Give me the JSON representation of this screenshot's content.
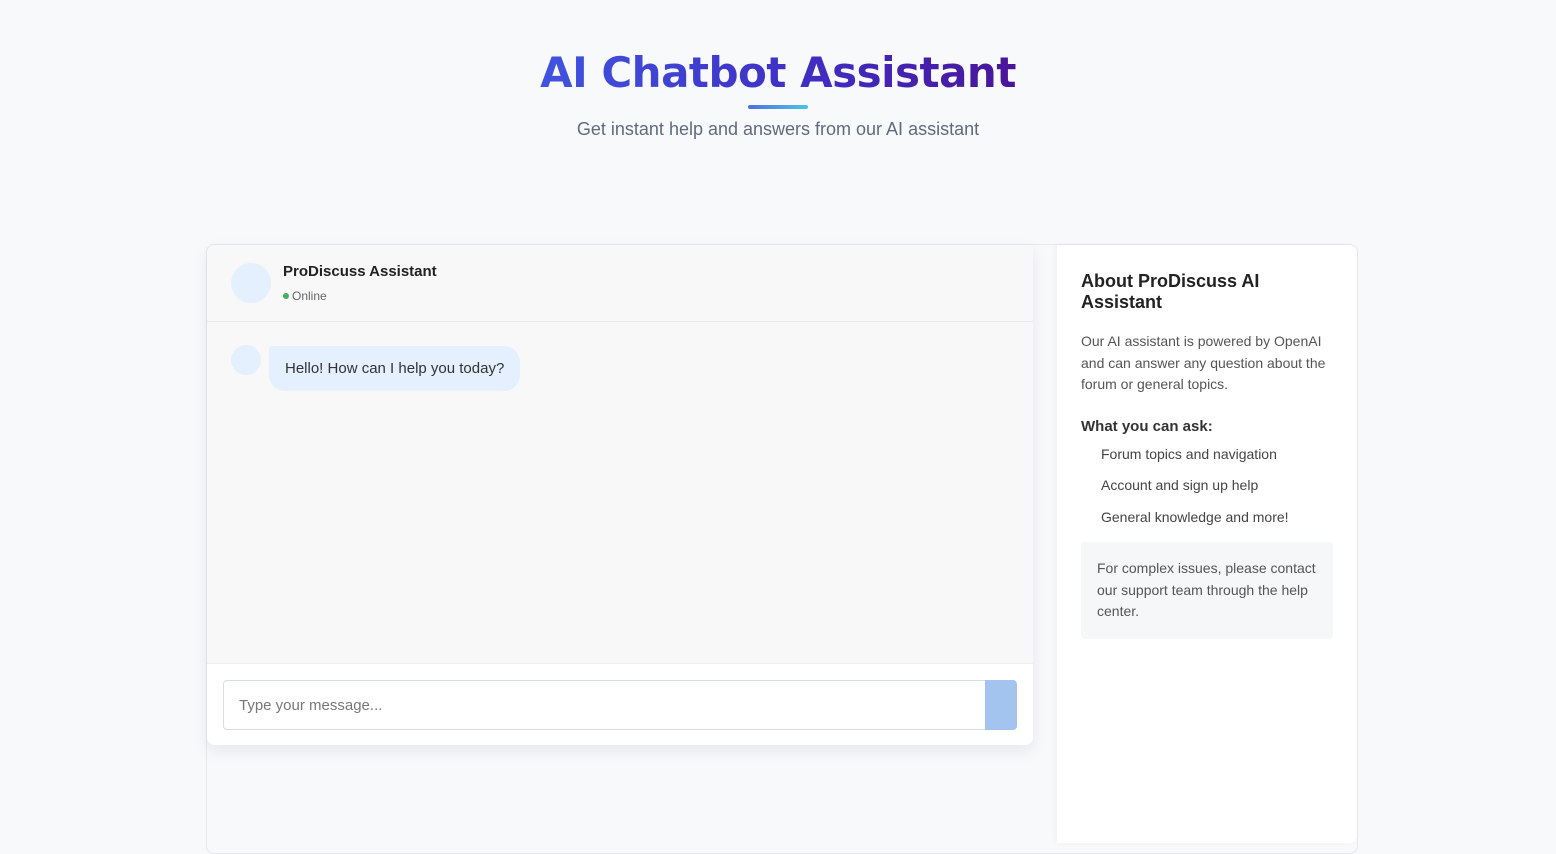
{
  "header": {
    "title": "AI Chatbot Assistant",
    "subtitle": "Get instant help and answers from our AI assistant"
  },
  "chat": {
    "assistant_name": "ProDiscuss Assistant",
    "status": "Online",
    "messages": [
      {
        "sender": "bot",
        "text": "Hello! How can I help you today?"
      }
    ],
    "input": {
      "placeholder": "Type your message...",
      "value": ""
    }
  },
  "info": {
    "title": "About ProDiscuss AI Assistant",
    "description": "Our AI assistant is powered by OpenAI and can answer any question about the forum or general topics.",
    "ask_heading": "What you can ask:",
    "ask_items": [
      "Forum topics and navigation",
      "Account and sign up help",
      "General knowledge and more!"
    ],
    "contact_note": "For complex issues, please contact our support team through the help center."
  },
  "colors": {
    "accent": "#4054e0",
    "online": "#3cb25c",
    "bubble": "#e4f0fd",
    "send_button": "#a2c4ef"
  },
  "icons": {
    "send_button": "send-icon",
    "status": "status-dot-icon"
  }
}
